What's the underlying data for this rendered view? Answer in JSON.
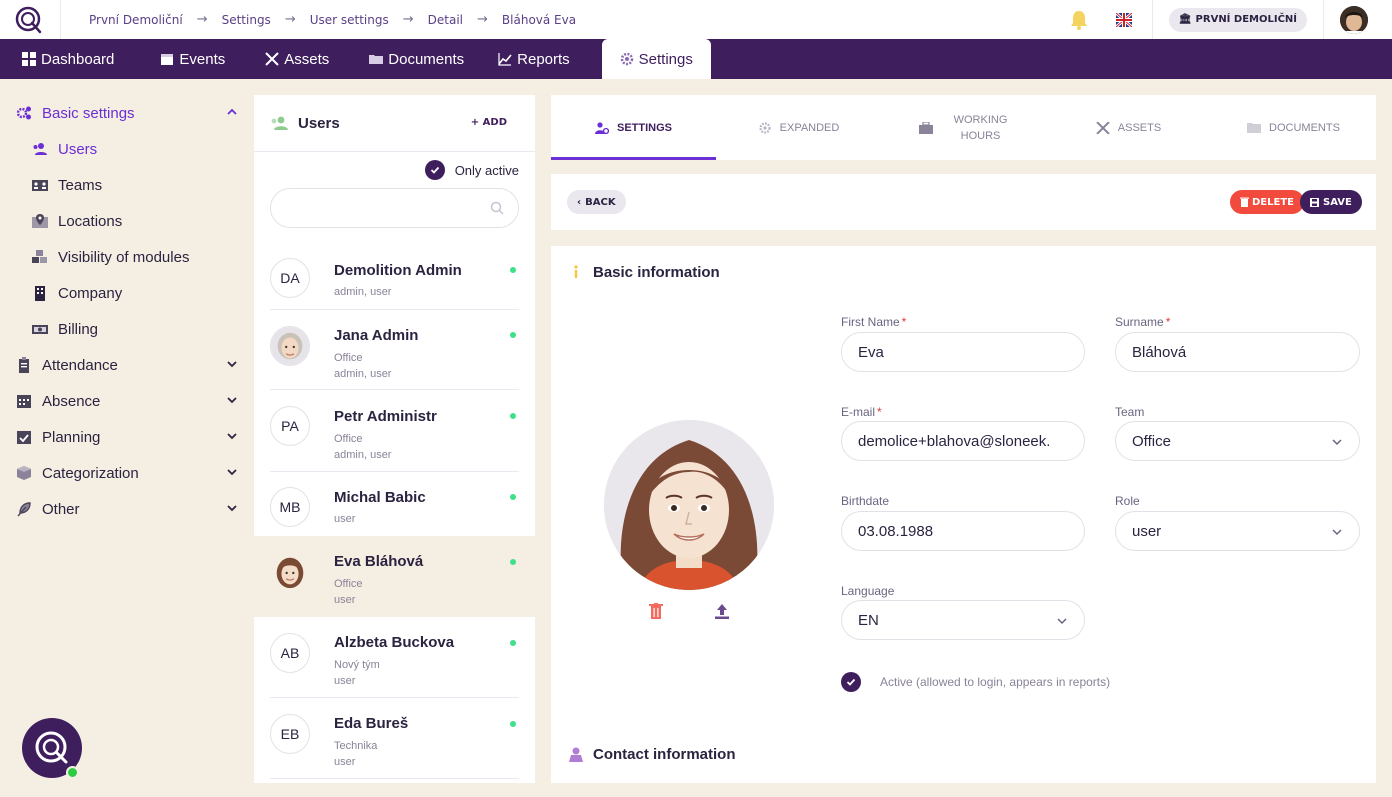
{
  "breadcrumb": [
    "První Demoliční",
    "Settings",
    "User settings",
    "Detail",
    "Bláhová Eva"
  ],
  "org_button": "PRVNÍ DEMOLIČNÍ",
  "nav": [
    {
      "label": "Dashboard",
      "icon": "grid-icon"
    },
    {
      "label": "Events",
      "icon": "calendar-icon"
    },
    {
      "label": "Assets",
      "icon": "tools-icon"
    },
    {
      "label": "Documents",
      "icon": "folder-icon"
    },
    {
      "label": "Reports",
      "icon": "chart-icon"
    },
    {
      "label": "Settings",
      "icon": "gear-icon",
      "active": true
    }
  ],
  "sidebar": {
    "basic": "Basic settings",
    "sub": [
      "Users",
      "Teams",
      "Locations",
      "Visibility of modules",
      "Company",
      "Billing"
    ],
    "groups": [
      "Attendance",
      "Absence",
      "Planning",
      "Categorization",
      "Other"
    ]
  },
  "users_panel": {
    "title": "Users",
    "add": "ADD",
    "only_active": "Only active",
    "search_placeholder": "",
    "users": [
      {
        "initials": "DA",
        "name": "Demolition Admin",
        "line1": "admin, user",
        "line2": ""
      },
      {
        "initials": "",
        "name": "Jana Admin",
        "line1": "Office",
        "line2": "admin, user"
      },
      {
        "initials": "PA",
        "name": "Petr Administr",
        "line1": "Office",
        "line2": "admin, user"
      },
      {
        "initials": "MB",
        "name": "Michal Babic",
        "line1": "user",
        "line2": ""
      },
      {
        "initials": "",
        "name": "Eva Bláhová",
        "line1": "Office",
        "line2": "user"
      },
      {
        "initials": "AB",
        "name": "Alzbeta Buckova",
        "line1": "Nový tým",
        "line2": "user"
      },
      {
        "initials": "EB",
        "name": "Eda Bureš",
        "line1": "Technika",
        "line2": "user"
      }
    ]
  },
  "tabs": [
    {
      "label": "SETTINGS"
    },
    {
      "label": "EXPANDED"
    },
    {
      "label": "WORKING HOURS"
    },
    {
      "label": "ASSETS"
    },
    {
      "label": "DOCUMENTS"
    }
  ],
  "actions": {
    "back": "BACK",
    "delete": "DELETE",
    "save": "SAVE"
  },
  "form": {
    "section_basic": "Basic information",
    "section_contact": "Contact information",
    "first_name_label": "First Name",
    "first_name": "Eva",
    "surname_label": "Surname",
    "surname": "Bláhová",
    "email_label": "E-mail",
    "email": "demolice+blahova@sloneek.",
    "team_label": "Team",
    "team": "Office",
    "birthdate_label": "Birthdate",
    "birthdate": "03.08.1988",
    "role_label": "Role",
    "role": "user",
    "language_label": "Language",
    "language": "EN",
    "required_mark": "*",
    "active_label": "Active (allowed to login, appears in reports)"
  },
  "colors": {
    "brand": "#3f1e5e",
    "accent": "#6b2fd4",
    "delete": "#f24a3d",
    "online": "#3ee08a"
  }
}
